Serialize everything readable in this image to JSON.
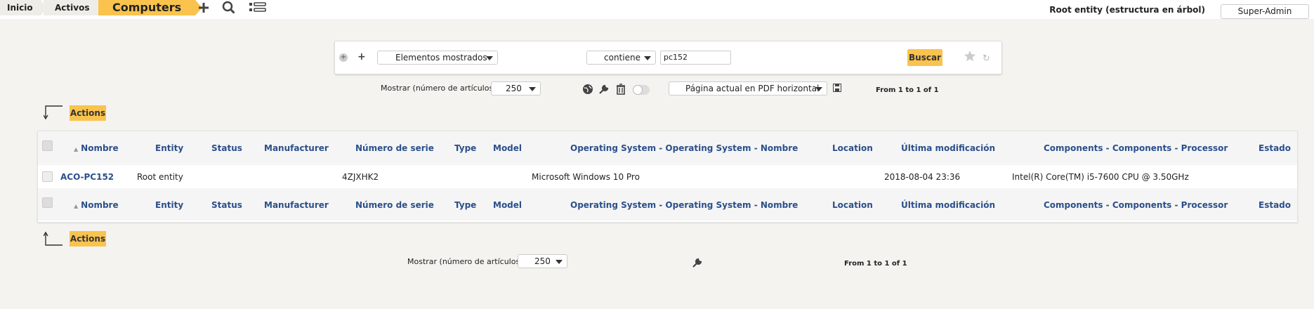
{
  "breadcrumbs": [
    "Inicio",
    "Activos",
    "Computers"
  ],
  "top_icons": [
    "plus-icon",
    "search-icon",
    "list-icon"
  ],
  "entity": "Root entity (estructura en árbol)",
  "profile": "Super-Admin",
  "search": {
    "field": "Elementos mostrados",
    "operator": "contiene",
    "value": "pc152",
    "button": "Buscar"
  },
  "pager": {
    "show_label": "Mostrar (número de artículos)",
    "show_value": "250",
    "export": "Página actual en PDF horizontal",
    "range": "From 1 to 1 of 1"
  },
  "actions_label": "Actions",
  "table": {
    "columns": [
      "Nombre",
      "Entity",
      "Status",
      "Manufacturer",
      "Número de serie",
      "Type",
      "Model",
      "Operating System - Operating System - Nombre",
      "Location",
      "Última modificación",
      "Components - Components - Processor",
      "Estado"
    ],
    "rows": [
      {
        "name": "ACO-PC152",
        "entity": "Root entity",
        "status": "",
        "manufacturer": "",
        "serial": "4ZJXHK2",
        "type": "",
        "model": "",
        "os": "Microsoft Windows 10 Pro",
        "location": "",
        "modified": "2018-08-04 23:36",
        "processor": "Intel(R) Core(TM) i5-7600 CPU @ 3.50GHz",
        "state": ""
      }
    ]
  },
  "colors": {
    "accent": "#f9c34e",
    "link": "#2b4f8a"
  }
}
